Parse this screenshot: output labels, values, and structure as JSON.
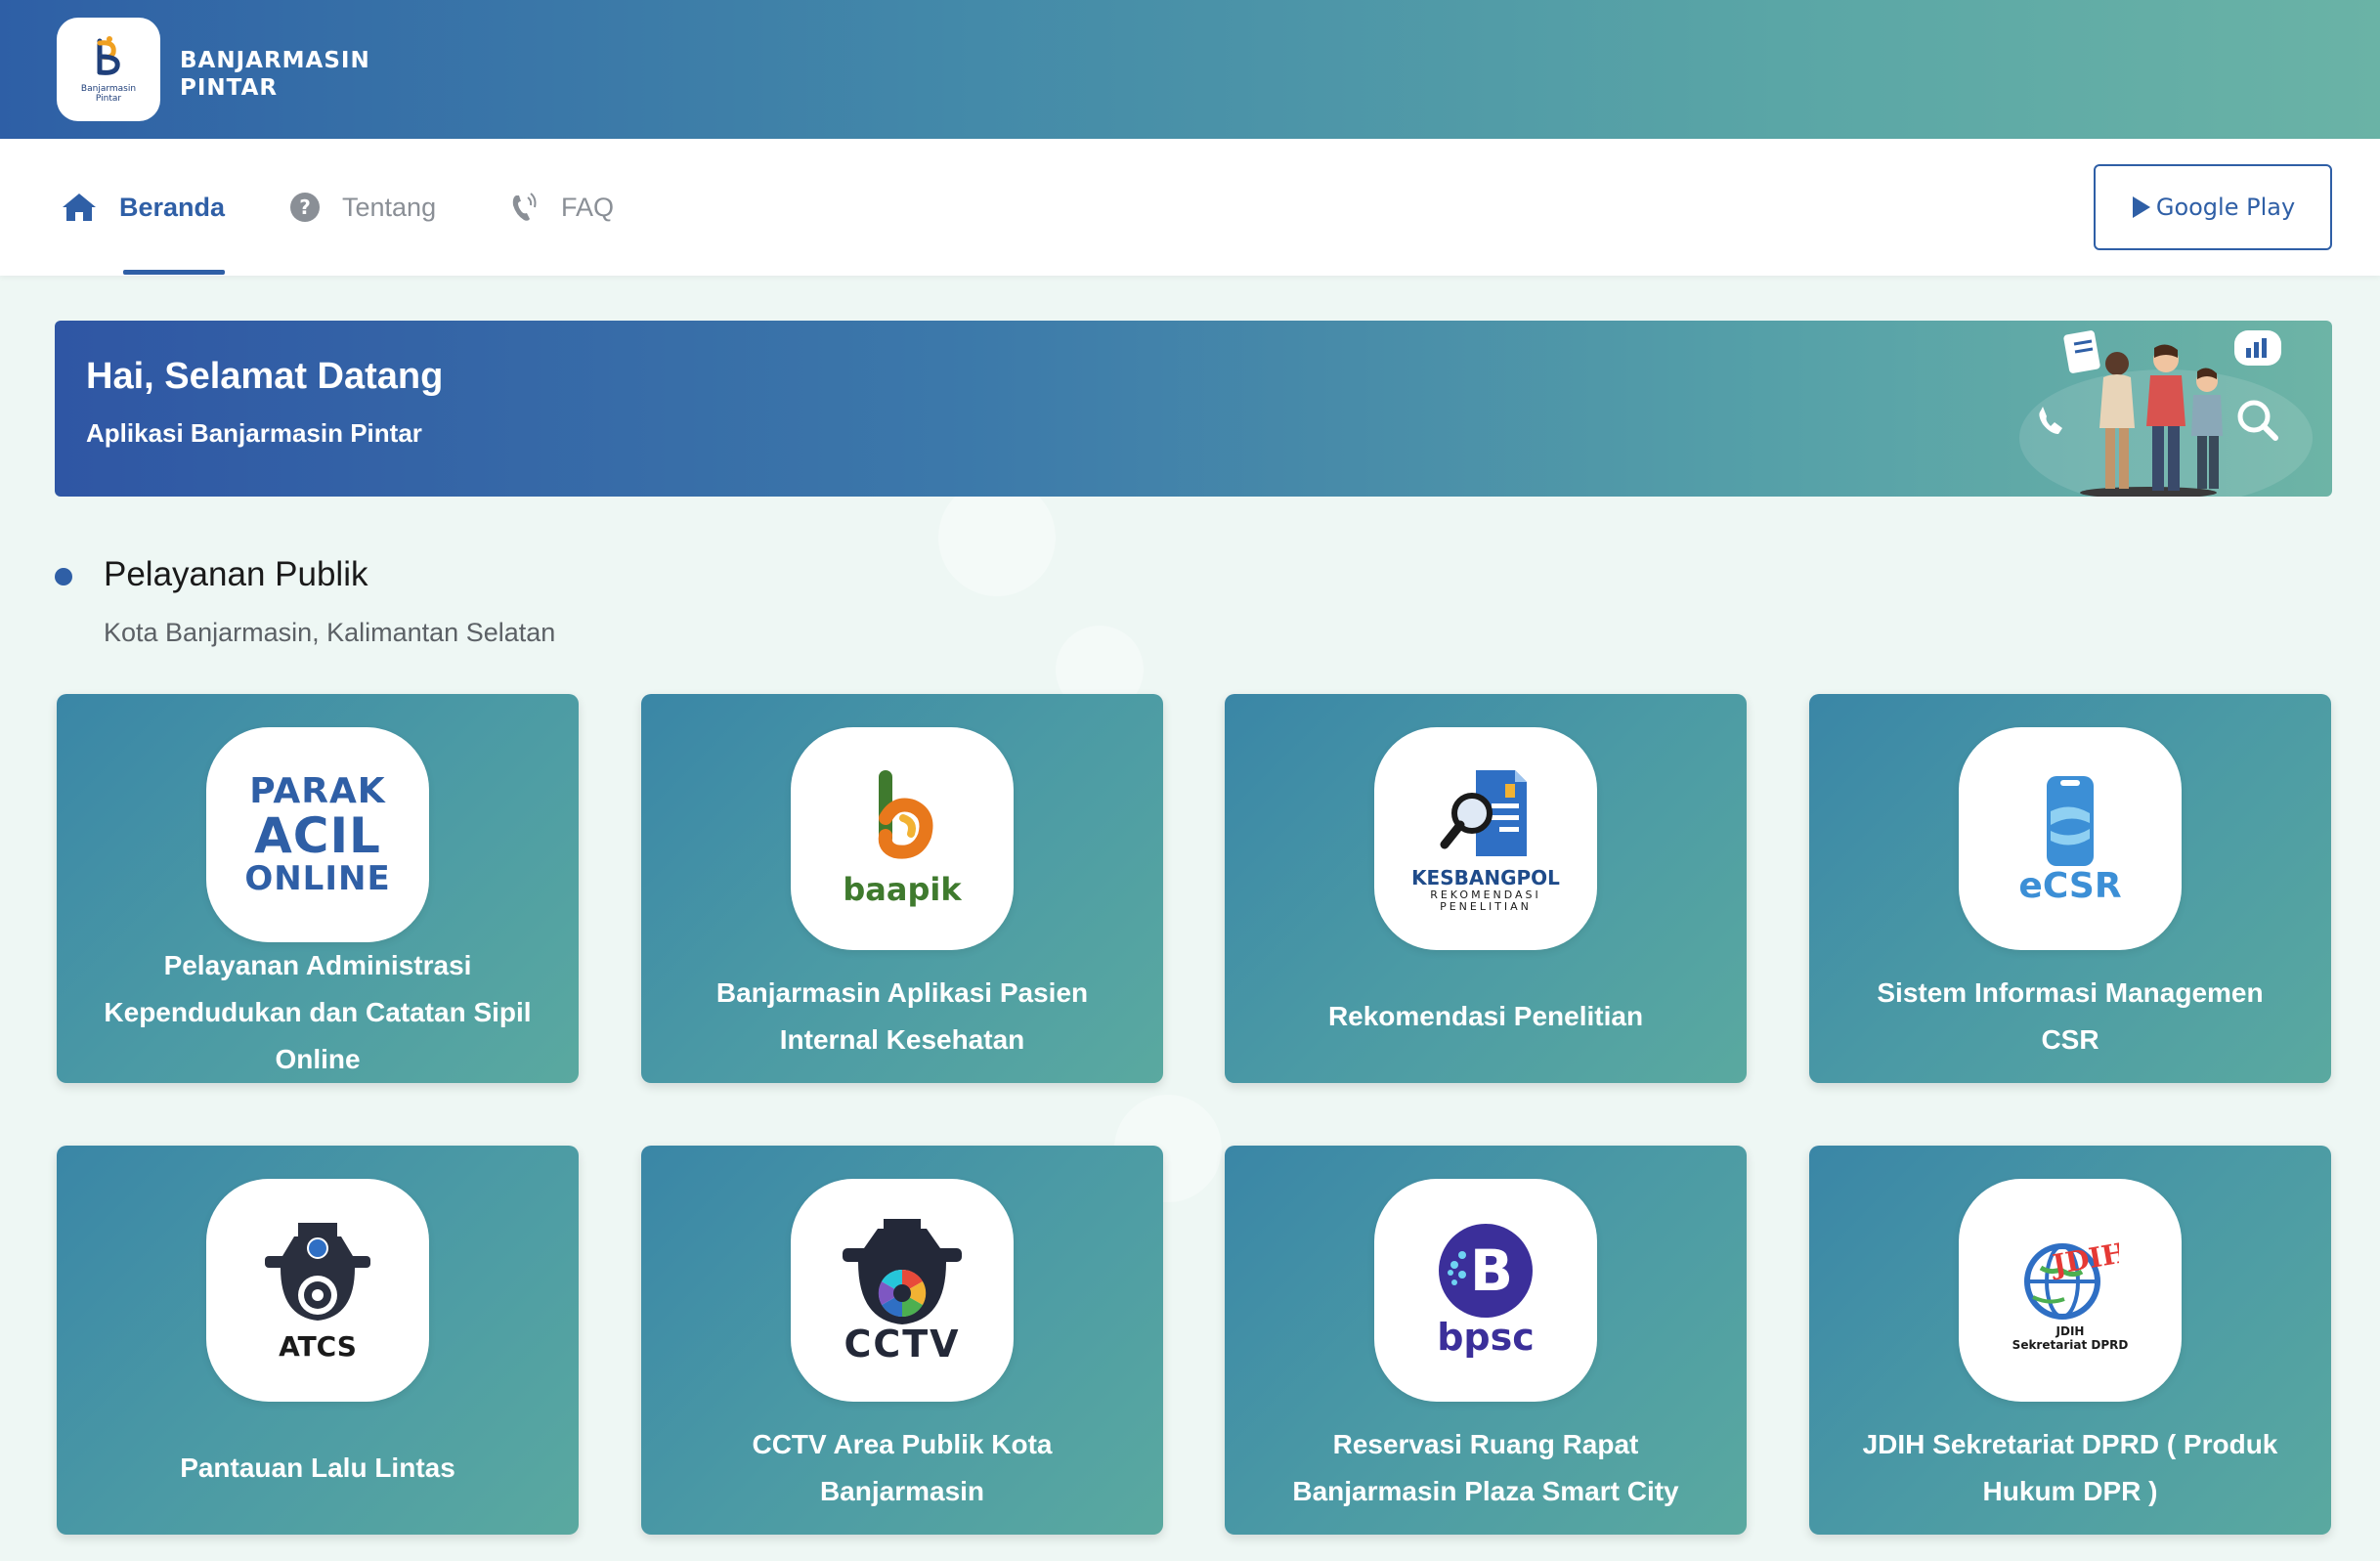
{
  "header": {
    "brand_line1": "BANJARMASIN",
    "brand_line2": "PINTAR",
    "logo_text_line1": "Banjarmasin",
    "logo_text_line2": "Pintar"
  },
  "nav": {
    "items": [
      {
        "label": "Beranda",
        "icon": "home-icon",
        "active": true
      },
      {
        "label": "Tentang",
        "icon": "question-circle-icon",
        "active": false
      },
      {
        "label": "FAQ",
        "icon": "phone-volume-icon",
        "active": false
      }
    ],
    "google_play_label": "Google Play"
  },
  "banner": {
    "title": "Hai, Selamat Datang",
    "subtitle": "Aplikasi Banjarmasin Pintar"
  },
  "section": {
    "title": "Pelayanan Publik",
    "subtitle": "Kota Banjarmasin, Kalimantan Selatan"
  },
  "cards": [
    {
      "label": "Pelayanan Administrasi Kependudukan dan Catatan Sipil Online",
      "icon": "parak-acil-online-logo",
      "logo_text": [
        "PARAK",
        "ACIL",
        "ONLINE"
      ]
    },
    {
      "label": "Banjarmasin Aplikasi Pasien Internal Kesehatan",
      "icon": "baapik-logo",
      "logo_text": [
        "baapik"
      ]
    },
    {
      "label": "Rekomendasi Penelitian",
      "icon": "kesbangpol-logo",
      "logo_text": [
        "KESBANGPOL",
        "REKOMENDASI",
        "PENELITIAN"
      ]
    },
    {
      "label": "Sistem Informasi Managemen CSR",
      "icon": "ecsr-logo",
      "logo_text": [
        "eCSR"
      ]
    },
    {
      "label": "Pantauan Lalu Lintas",
      "icon": "atcs-logo",
      "logo_text": [
        "ATCS"
      ]
    },
    {
      "label": "CCTV Area Publik Kota Banjarmasin",
      "icon": "cctv-logo",
      "logo_text": [
        "CCTV"
      ]
    },
    {
      "label": "Reservasi Ruang Rapat Banjarmasin Plaza Smart City",
      "icon": "bpsc-logo",
      "logo_text": [
        "bpsc"
      ]
    },
    {
      "label": "JDIH Sekretariat DPRD ( Produk Hukum DPR )",
      "icon": "jdih-logo",
      "logo_text": [
        "JDIH",
        "JDIH",
        "Sekretariat DPRD"
      ]
    }
  ],
  "colors": {
    "primary": "#2f5fa6",
    "teal": "#5aa6a6",
    "background": "#eef7f4",
    "baapik_green": "#3f7a2e",
    "baapik_orange": "#e8781c",
    "ecsr_blue": "#3c8fd6",
    "bpsc_purple": "#3b2f9a"
  }
}
